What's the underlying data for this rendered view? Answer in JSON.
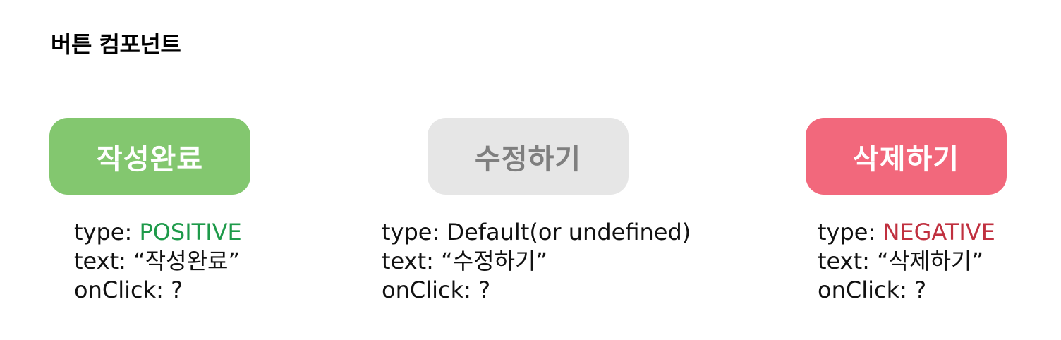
{
  "page": {
    "title": "버튼 컴포넌트"
  },
  "buttons": [
    {
      "label": "작성완료",
      "type_label": "type:",
      "type_value": "POSITIVE",
      "text_label": "text:",
      "text_value": "“작성완료”",
      "onclick_label": "onClick:",
      "onclick_value": "?"
    },
    {
      "label": "수정하기",
      "type_label": "type:",
      "type_value": "Default(or undefined)",
      "text_label": "text:",
      "text_value": "“수정하기”",
      "onclick_label": "onClick:",
      "onclick_value": "?"
    },
    {
      "label": "삭제하기",
      "type_label": "type:",
      "type_value": "NEGATIVE",
      "text_label": "text:",
      "text_value": "“삭제하기”",
      "onclick_label": "onClick:",
      "onclick_value": "?"
    }
  ],
  "colors": {
    "positive_bg": "#83c76f",
    "default_bg": "#e6e6e6",
    "default_text": "#7f7f7f",
    "negative_bg": "#f2687c",
    "positive_value": "#1e9a4a",
    "negative_value": "#c0303f"
  }
}
